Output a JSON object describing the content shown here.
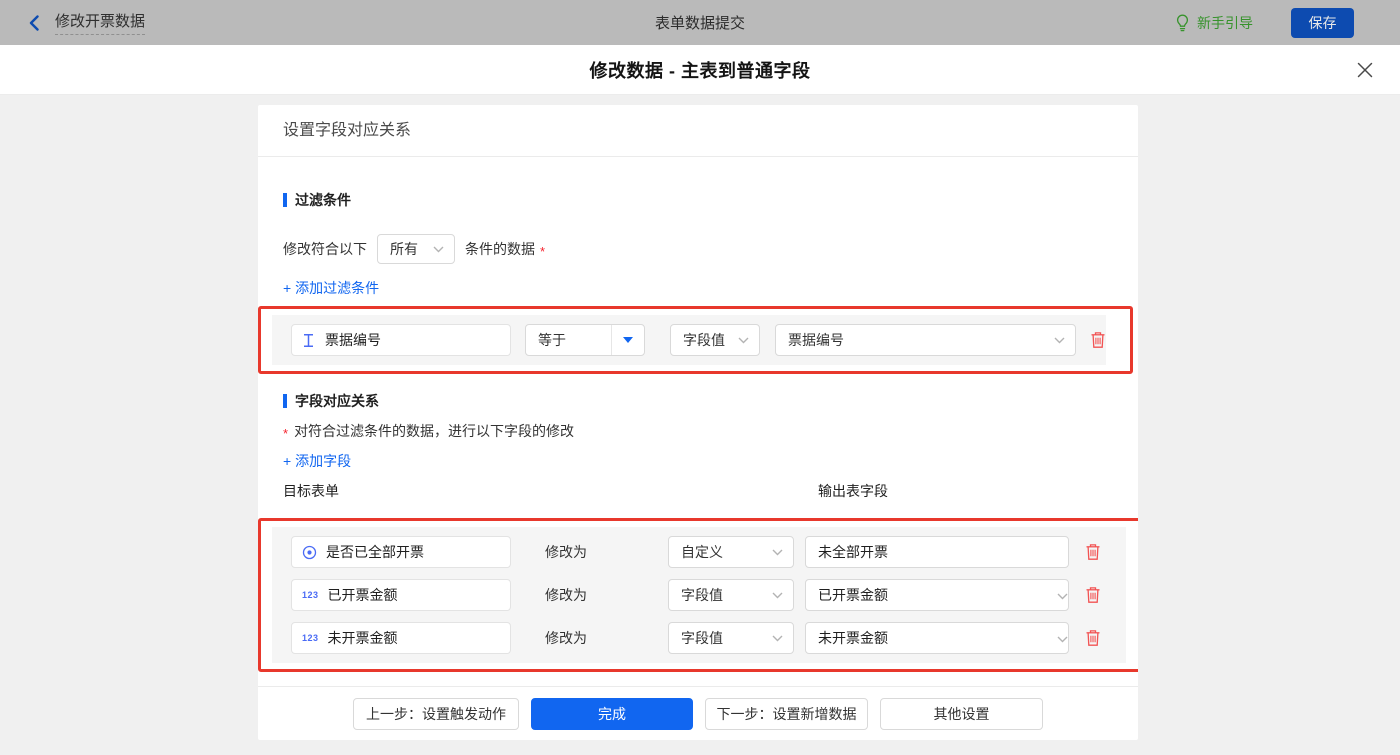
{
  "colors": {
    "accent_blue": "#1166f0",
    "highlight_red": "#e8382c",
    "trash_red": "#f25353",
    "guide_green": "#37932c",
    "dimmed_topbar_bg": "#bababa",
    "dimmed_save_blue": "#0d4bb0",
    "row_bg": "#f5f5f5"
  },
  "topbar": {
    "back_label": "修改开票数据",
    "center_title": "表单数据提交",
    "guide_label": "新手引导",
    "save_label": "保存"
  },
  "dialog": {
    "title": "修改数据 - 主表到普通字段",
    "panel_header": "设置字段对应关系",
    "filter": {
      "section_title": "过滤条件",
      "prefix": "修改符合以下",
      "match_value": "所有",
      "suffix": "条件的数据",
      "required_mark": "*",
      "add_label": "+ 添加过滤条件",
      "condition": {
        "field": "票据编号",
        "operator": "等于",
        "value_type": "字段值",
        "value_field": "票据编号"
      }
    },
    "mapping": {
      "section_title": "字段对应关系",
      "required_mark": "*",
      "description": "对符合过滤条件的数据，进行以下字段的修改",
      "add_label": "+ 添加字段",
      "col_left": "目标表单",
      "col_right": "输出表字段",
      "modify_label": "修改为",
      "number_icon_label": "123",
      "rows": [
        {
          "field": "是否已全部开票",
          "mode": "自定义",
          "value": "未全部开票"
        },
        {
          "field": "已开票金额",
          "mode": "字段值",
          "value": "已开票金额"
        },
        {
          "field": "未开票金额",
          "mode": "字段值",
          "value": "未开票金额"
        }
      ]
    },
    "footer": {
      "prev_label": "上一步：设置触发动作",
      "done_label": "完成",
      "next_label": "下一步：设置新增数据",
      "other_label": "其他设置"
    }
  }
}
